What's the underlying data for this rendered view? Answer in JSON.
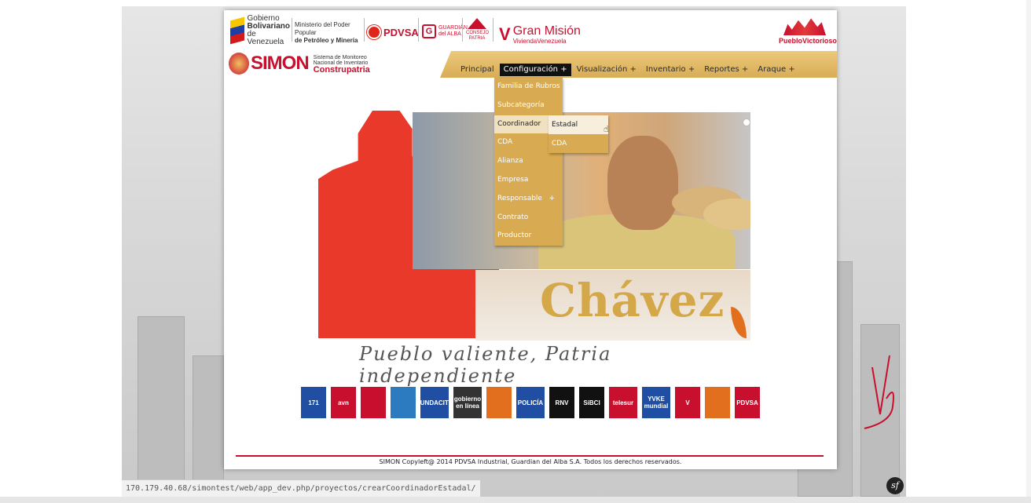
{
  "header": {
    "gobierno": {
      "line1": "Gobierno",
      "line2": "Bolivariano",
      "line3": "de Venezuela"
    },
    "ministerio": {
      "line1": "Ministerio del Poder Popular",
      "line2": "de Petróleo y Minería"
    },
    "pdvsa": "PDVSA",
    "guardian": "GUARDIÁN del ALBA",
    "consejo": "CONSEJO PATRIA",
    "gran_mision": {
      "title": "Gran Misión",
      "sub": "ViviendaVenezuela"
    },
    "pueblo_victorioso": "PuebloVictorioso"
  },
  "simon": {
    "logo": "SIMON",
    "sub1": "Sistema de Monitoreo",
    "sub2": "Nacional de Inventario",
    "sub3": "Construpatria"
  },
  "nav": {
    "items": [
      {
        "label": "Principal"
      },
      {
        "label": "Configuración  +"
      },
      {
        "label": "Visualización  +"
      },
      {
        "label": "Inventario  +"
      },
      {
        "label": "Reportes  +"
      },
      {
        "label": "Araque  +"
      }
    ]
  },
  "config_menu": {
    "items": [
      {
        "label": "Familia de Rubros"
      },
      {
        "label": "Subcategoría"
      },
      {
        "label": "Coordinador"
      },
      {
        "label": "CDA"
      },
      {
        "label": "Alianza"
      },
      {
        "label": "Empresa"
      },
      {
        "label": "Responsable",
        "plus": "+"
      },
      {
        "label": "Contrato"
      },
      {
        "label": "Productor"
      }
    ]
  },
  "coordinador_submenu": {
    "items": [
      {
        "label": "Estadal"
      },
      {
        "label": "CDA"
      }
    ]
  },
  "hero": {
    "name": "Chávez",
    "slogan": "Pueblo valiente, Patria independiente"
  },
  "sponsors": [
    {
      "label": "171",
      "color": "#1f4ea3"
    },
    {
      "label": "avn",
      "color": "#c8102e"
    },
    {
      "label": "",
      "color": "#c8102e"
    },
    {
      "label": "",
      "color": "#2c7bc0"
    },
    {
      "label": "FUNDACITE",
      "color": "#1f4ea3"
    },
    {
      "label": "gobierno en línea",
      "color": "#333333"
    },
    {
      "label": "",
      "color": "#e26f1d"
    },
    {
      "label": "POLICÍA",
      "color": "#1f4ea3"
    },
    {
      "label": "RNV",
      "color": "#111111"
    },
    {
      "label": "SiBCI",
      "color": "#111111"
    },
    {
      "label": "telesur",
      "color": "#c8102e"
    },
    {
      "label": "YVKE mundial",
      "color": "#1f4ea3"
    },
    {
      "label": "V",
      "color": "#c8102e"
    },
    {
      "label": "",
      "color": "#e26f1d"
    },
    {
      "label": "PDVSA",
      "color": "#c8102e"
    }
  ],
  "footer": {
    "text": "SIMON Copyleft@ 2014 PDVSA Industrial, Guardian del Alba S.A. Todos los derechos reservados."
  },
  "status": {
    "url": "170.179.40.68/simontest/web/app_dev.php/proyectos/crearCoordinadorEstadal/"
  },
  "colors": {
    "accent": "#d8ab52",
    "brand_red": "#c8102e",
    "active_nav": "#111111"
  }
}
